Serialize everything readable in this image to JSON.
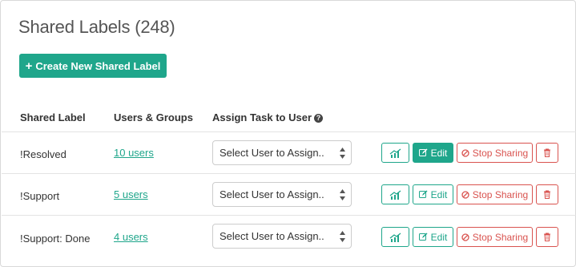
{
  "page": {
    "title": "Shared Labels (248)"
  },
  "actions": {
    "create_label": "Create New Shared Label"
  },
  "table": {
    "headers": {
      "label": "Shared Label",
      "users": "Users & Groups",
      "assign": "Assign Task to User"
    },
    "rows": [
      {
        "label": "!Resolved",
        "users": "10 users",
        "select": "Select User to Assign..",
        "edit": "Edit",
        "stop": "Stop Sharing"
      },
      {
        "label": "!Support",
        "users": "5 users",
        "select": "Select User to Assign..",
        "edit": "Edit",
        "stop": "Stop Sharing"
      },
      {
        "label": "!Support: Done",
        "users": "4 users",
        "select": "Select User to Assign..",
        "edit": "Edit",
        "stop": "Stop Sharing"
      }
    ]
  },
  "colors": {
    "accent": "#1fa68b",
    "danger": "#d9534f"
  },
  "icons": [
    "plus-icon",
    "question-circle-icon",
    "chart-icon",
    "edit-icon",
    "ban-icon",
    "trash-icon",
    "select-arrows-icon"
  ]
}
